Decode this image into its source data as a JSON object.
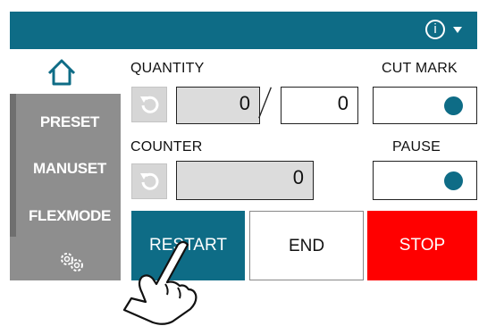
{
  "header": {
    "info_label": "i"
  },
  "sidebar": {
    "items": [
      {
        "label": "PRESET"
      },
      {
        "label": "MANUSET"
      },
      {
        "label": "FLEXMODE"
      }
    ]
  },
  "quantity": {
    "label": "QUANTITY",
    "current": "0",
    "target": "0"
  },
  "counter": {
    "label": "COUNTER",
    "value": "0"
  },
  "cut_mark": {
    "label": "CUT MARK"
  },
  "pause": {
    "label": "PAUSE"
  },
  "actions": {
    "restart": "RESTART",
    "end": "END",
    "stop": "STOP"
  },
  "colors": {
    "accent": "#0e6c86",
    "stop": "#ff0000",
    "sidebar": "#8e8e8e"
  },
  "icons": [
    "home-icon",
    "info-icon",
    "reset-icon",
    "settings-gears-icon",
    "pointing-hand-icon"
  ]
}
